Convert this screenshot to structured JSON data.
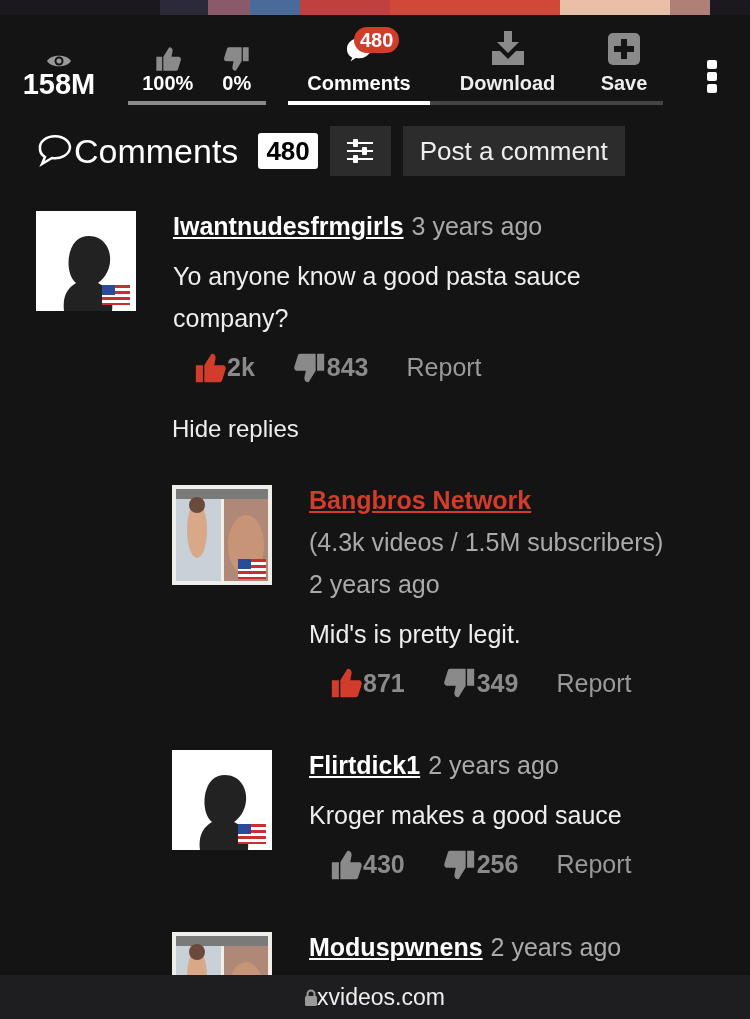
{
  "stats": {
    "views": "158M",
    "likes": "100%",
    "dislikes": "0%"
  },
  "tabs": [
    {
      "kind": "comments",
      "label": "Comments",
      "badge": "480",
      "selected": true
    },
    {
      "kind": "download",
      "label": "Download",
      "selected": false
    },
    {
      "kind": "save",
      "label": "Save",
      "selected": false
    }
  ],
  "comments_header": {
    "title": "Comments",
    "count": "480",
    "post_button": "Post a comment"
  },
  "comments": [
    {
      "kind": "user",
      "author": "Iwantnudesfrmgirls",
      "time": "3 years ago",
      "avatar": {
        "kind": "silhouette"
      },
      "flag": true,
      "text": "Yo anyone know a good pasta sauce company?",
      "likes": "2k",
      "dislikes": "843",
      "liked": true,
      "report": "Report",
      "replies_toggle": "Hide replies",
      "children": [
        {
          "kind": "channel",
          "author": "Bangbros Network",
          "info": "(4.3k videos / 1.5M subscribers)",
          "time": "2 years ago",
          "flag": true,
          "text": "Mid's is pretty legit.",
          "likes": "871",
          "dislikes": "349",
          "liked": true,
          "report": "Report"
        },
        {
          "kind": "user",
          "author": "Flirtdick1",
          "time": "2 years ago",
          "avatar": {
            "kind": "silhouette"
          },
          "flag": true,
          "text": "Kroger makes a good sauce",
          "likes": "430",
          "dislikes": "256",
          "liked": false,
          "report": "Report"
        },
        {
          "kind": "user",
          "author": "Moduspwnens",
          "time": "2 years ago",
          "flag": false
        }
      ]
    }
  ],
  "address_bar": {
    "url": "xvideos.com"
  }
}
